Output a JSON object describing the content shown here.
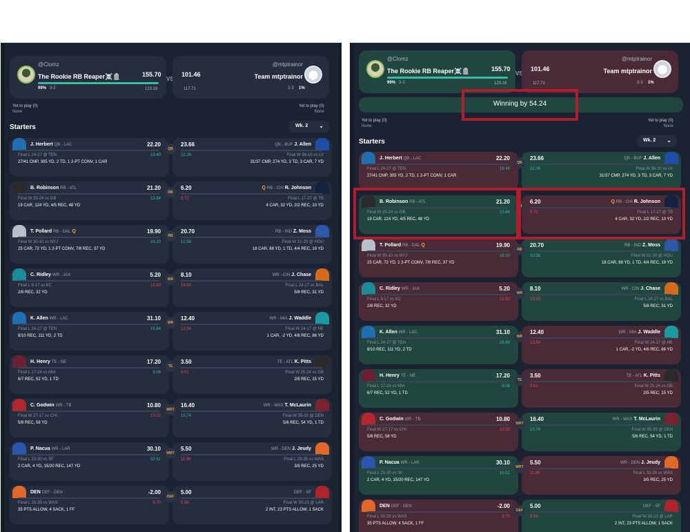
{
  "matchup": {
    "left_user": "@Clomz",
    "left_team": "The Rookie RB Reaper☠️🪦",
    "left_score": "155.70",
    "left_proj": "123.18",
    "left_pct": "99%",
    "left_record": "3-2",
    "right_user": "@mtptrainor",
    "right_team": "Team mtptrainor",
    "right_score": "101.46",
    "right_proj": "117.71",
    "right_pct": "1%",
    "right_record": "2-3",
    "vs": "VS"
  },
  "yet_to_play": {
    "label": "Yet to play (0)",
    "none": "None"
  },
  "winning_label": "Winning by 54.24",
  "starters_label": "Starters",
  "week_label": "Wk. 2",
  "colors": {
    "accent": "#35bfa0",
    "loss": "#e3485b",
    "highlight": "#b01e2b",
    "bg": "#1b2232"
  },
  "rows": [
    {
      "slot": "QB",
      "l": {
        "name": "J. Herbert",
        "pos": "QB - LAC",
        "q": "",
        "pts": "22.20",
        "game": "Final L 24-27 @ TEN",
        "proj": "19.49",
        "proj_class": "green",
        "stat": "27/41 CMP, 305 YD, 2 TD, 1 2-PT CONV, 1 CAR",
        "hs": "#1f6fb2"
      },
      "r": {
        "name": "J. Allen",
        "pos": "QB - BUF",
        "q": "",
        "pts": "23.66",
        "game": "Final W 38-10 vs LV",
        "proj": "22.26",
        "proj_class": "green",
        "stat": "31/37 CMP, 274 YD, 3 TD, 3 CAR, 7 YD",
        "hs": "#1e4ea8"
      },
      "winner": "r"
    },
    {
      "slot": "RB",
      "l": {
        "name": "B. Robinson",
        "pos": "RB - ATL",
        "q": "",
        "pts": "21.20",
        "game": "Final W 25-24 vs GB",
        "proj": "13.64",
        "proj_class": "green",
        "stat": "19 CAR, 124 YD, 4/5 REC, 48 YD",
        "hs": "#2a2a2a"
      },
      "r": {
        "name": "R. Johnson",
        "pos": "RB - CHI",
        "q": "Q",
        "pts": "6.20",
        "game": "Final L 17-27 @ TB",
        "proj": "9.72",
        "proj_class": "red",
        "stat": "4 CAR, 32 YD, 2/2 REC, 10 YD",
        "hs": "#12223f"
      },
      "winner": "l"
    },
    {
      "slot": "RB",
      "l": {
        "name": "T. Pollard",
        "pos": "RB - DAL",
        "q": "Q",
        "pts": "19.90",
        "game": "Final W 30-10 vs NYJ",
        "proj": "16.10",
        "proj_class": "green",
        "stat": "25 CAR, 72 YD, 1 2-PT CONV, 7/8 REC, 37 YD",
        "hs": "#b8c0cc"
      },
      "r": {
        "name": "Z. Moss",
        "pos": "RB - IND",
        "q": "",
        "pts": "20.70",
        "game": "Final W 31-20 @ HOU",
        "proj": "10.56",
        "proj_class": "green",
        "stat": "18 CAR, 88 YD, 1 TD, 4/4 REC, 19 YD",
        "hs": "#2d5aa8"
      },
      "winner": "r"
    },
    {
      "slot": "WR",
      "l": {
        "name": "C. Ridley",
        "pos": "WR - JAX",
        "q": "",
        "pts": "5.20",
        "game": "Final L 9-17 vs KC",
        "proj": "15.83",
        "proj_class": "red",
        "stat": "2/8 REC, 32 YD",
        "hs": "#1b8a99"
      },
      "r": {
        "name": "J. Chase",
        "pos": "WR - CIN",
        "q": "",
        "pts": "8.10",
        "game": "Final L 24-27 vs BAL",
        "proj": "19.93",
        "proj_class": "red",
        "stat": "5/8 REC, 31 YD",
        "hs": "#d36b1c"
      },
      "winner": "r"
    },
    {
      "slot": "WR",
      "l": {
        "name": "K. Allen",
        "pos": "WR - LAC",
        "q": "",
        "pts": "31.10",
        "game": "Final L 24-27 @ TEN",
        "proj": "16.84",
        "proj_class": "green",
        "stat": "8/10 REC, 111 YD, 2 TD",
        "hs": "#1f6fb2"
      },
      "r": {
        "name": "J. Waddle",
        "pos": "WR - MIA",
        "q": "",
        "pts": "12.40",
        "game": "Final W 24-17 @ NE",
        "proj": "13.54",
        "proj_class": "red",
        "stat": "1 CAR, -2 YD, 4/6 REC, 86 YD",
        "hs": "#1b9aa1"
      },
      "winner": "l"
    },
    {
      "slot": "TE",
      "l": {
        "name": "H. Henry",
        "pos": "TE - NE",
        "q": "",
        "pts": "17.20",
        "game": "Final L 17-24 vs MIA",
        "proj": "8.06",
        "proj_class": "green",
        "stat": "6/7 REC, 52 YD, 1 TD",
        "hs": "#6a2232"
      },
      "r": {
        "name": "K. Pitts",
        "pos": "TE - ATL",
        "q": "",
        "pts": "3.50",
        "game": "Final W 25-24 vs GB",
        "proj": "9.01",
        "proj_class": "red",
        "stat": "2/5 REC, 15 YD",
        "hs": "#2a2a2a"
      },
      "winner": "l"
    },
    {
      "slot": "WRT",
      "l": {
        "name": "C. Godwin",
        "pos": "WR - TB",
        "q": "",
        "pts": "10.80",
        "game": "Final W 27-17 vs CHI",
        "proj": "13.02",
        "proj_class": "red",
        "stat": "5/8 REC, 58 YD",
        "hs": "#b0282b"
      },
      "r": {
        "name": "T. McLaurin",
        "pos": "WR - WAS",
        "q": "",
        "pts": "16.40",
        "game": "Final W 35-33 @ DEN",
        "proj": "10.74",
        "proj_class": "green",
        "stat": "5/6 REC, 54 YD, 1 TD",
        "hs": "#7a2230"
      },
      "winner": "r"
    },
    {
      "slot": "WRT",
      "l": {
        "name": "P. Nacua",
        "pos": "WR - LAR",
        "q": "",
        "pts": "30.10",
        "game": "Final L 23-30 vs SF",
        "proj": "10.51",
        "proj_class": "green",
        "stat": "2 CAR, 4 YD, 15/20 REC, 147 YD",
        "hs": "#2a56b0"
      },
      "r": {
        "name": "J. Jeudy",
        "pos": "WR - DEN",
        "q": "",
        "pts": "5.50",
        "game": "Final L 33-35 vs WAS",
        "proj": "11.96",
        "proj_class": "red",
        "stat": "3/5 REC, 25 YD",
        "hs": "#e0692a"
      },
      "winner": "l"
    },
    {
      "slot": "DEF",
      "l": {
        "name": "DEN",
        "pos": "DEF - DEN",
        "q": "",
        "pts": "-2.00",
        "game": "Final L 33-35 vs WAS",
        "proj": "9.70",
        "proj_class": "red",
        "stat": "35 PTS ALLOW, 4 SACK, 1 FF",
        "hs": "#e0692a"
      },
      "r": {
        "name": "",
        "pos": "DEF - SF",
        "q": "",
        "pts": "5.00",
        "game": "Final W 30-23 @ LAR",
        "proj": "9.98",
        "proj_class": "red",
        "stat": "2 INT, 23 PTS ALLOW, 1 SACK",
        "hs": "#b0232b"
      },
      "winner": "r"
    }
  ]
}
